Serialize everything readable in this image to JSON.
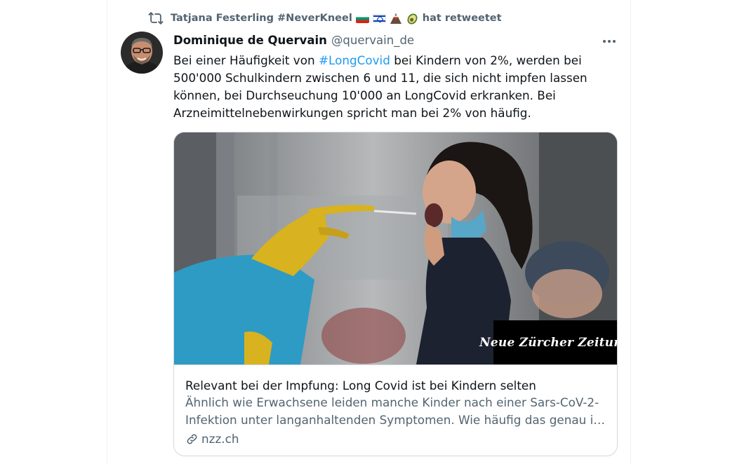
{
  "retweet": {
    "retweeter_name": "Tatjana Festerling #NeverKneel",
    "action_text": "hat retweetet",
    "emoji_icons": [
      "bulgaria-flag-icon",
      "israel-flag-icon",
      "volcano-icon",
      "avocado-icon"
    ]
  },
  "tweet": {
    "author_name": "Dominique de Quervain",
    "author_handle": "@quervain_de",
    "text_lines": [
      {
        "before": "Bei einer Häufigkeit von ",
        "hashtag": "#LongCovid",
        "after": " bei Kindern von 2%, werden bei"
      },
      {
        "text": "500'000 Schulkindern zwischen 6 und 11, die sich nicht impfen lassen"
      },
      {
        "text": "können, bei Durchseuchung 10'000 an LongCovid erkranken. Bei"
      },
      {
        "text": "Arzneimittelnebenwirkungen spricht man bei 2% von häufig."
      }
    ]
  },
  "card": {
    "image_watermark": "Neue Zürcher Zeitung",
    "title": "Relevant bei der Impfung: Long Covid ist bei Kindern selten",
    "description_lines": [
      "Ähnlich wie Erwachsene leiden manche Kinder nach einer Sars-CoV-2-",
      "Infektion unter langanhaltenden Symptomen. Wie häufig das genau is…"
    ],
    "domain": "nzz.ch"
  },
  "colors": {
    "text_primary": "#0f1419",
    "text_secondary": "#536471",
    "link_blue": "#1d9bf0",
    "border": "#cfd9de"
  }
}
